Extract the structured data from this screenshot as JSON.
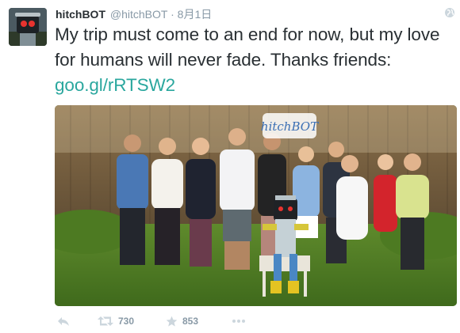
{
  "tweet": {
    "author": {
      "display_name": "hitchBOT",
      "handle": "@hitchBOT",
      "separator": "·",
      "timestamp": "8月1日"
    },
    "text": "My trip must come to an end for now, but my love for humans will never fade. Thanks friends: ",
    "link": "goo.gl/rRTSW2",
    "photo": {
      "sign_text": "hitchBOT"
    },
    "actions": {
      "retweet_count": "730",
      "favorite_count": "853"
    }
  },
  "colors": {
    "link": "#2aa79e",
    "meta": "#8899a6",
    "text": "#292f33"
  },
  "icons": [
    "avatar-robot",
    "globe-icon",
    "reply-icon",
    "retweet-icon",
    "star-icon",
    "more-icon"
  ]
}
